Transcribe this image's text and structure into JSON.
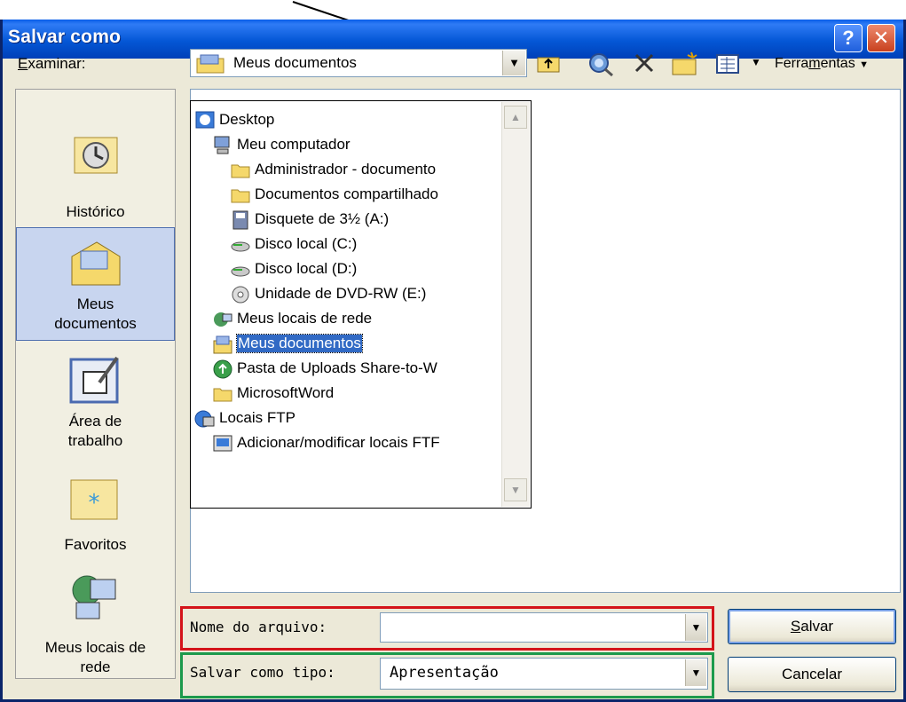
{
  "window": {
    "title": "Salvar como"
  },
  "titlebar": {
    "help": "?",
    "close": "✕"
  },
  "toolbar": {
    "look_in_label_u": "E",
    "look_in_label_rest": "xaminar:",
    "look_in_value": "Meus documentos",
    "tools_pre": "Ferra",
    "tools_u": "m",
    "tools_post": "entas"
  },
  "places": [
    {
      "label1": "Histórico",
      "label2": ""
    },
    {
      "label1": "Meus",
      "label2": "documentos"
    },
    {
      "label1": "Área de",
      "label2": "trabalho"
    },
    {
      "label1": "Favoritos",
      "label2": ""
    },
    {
      "label1": "Meus locais de",
      "label2": "rede"
    }
  ],
  "dropdown": {
    "items": [
      {
        "label": "Desktop",
        "icon": "desktop-icon"
      },
      {
        "label": "Meu computador",
        "icon": "computer-icon"
      },
      {
        "label": "Administrador - documento",
        "icon": "folder-icon"
      },
      {
        "label": "Documentos compartilhado",
        "icon": "folder-icon"
      },
      {
        "label": "Disquete de 3½ (A:)",
        "icon": "floppy-icon"
      },
      {
        "label": "Disco local (C:)",
        "icon": "drive-icon"
      },
      {
        "label": "Disco local (D:)",
        "icon": "drive-icon"
      },
      {
        "label": "Unidade de DVD-RW (E:)",
        "icon": "dvd-icon"
      },
      {
        "label": "Meus locais de rede",
        "icon": "network-icon"
      },
      {
        "label": "Meus documentos",
        "icon": "documents-icon"
      },
      {
        "label": "Pasta de Uploads Share-to-W",
        "icon": "upload-folder-icon"
      },
      {
        "label": "MicrosoftWord",
        "icon": "folder-icon"
      },
      {
        "label": "Locais FTP",
        "icon": "ftp-icon"
      },
      {
        "label": "Adicionar/modificar locais FTF",
        "icon": "ftp-add-icon"
      }
    ],
    "selected_index": 9
  },
  "form": {
    "filename_label": "Nome do arquivo:",
    "filename_value": "",
    "type_label": "Salvar como tipo:",
    "type_value": "Apresentação"
  },
  "buttons": {
    "save_u": "S",
    "save_rest": "alvar",
    "cancel": "Cancelar"
  },
  "colors": {
    "title_bar": "#0457d6",
    "selection": "#316ac5",
    "filename_highlight": "#d4141a",
    "type_highlight": "#1c9a4c"
  }
}
